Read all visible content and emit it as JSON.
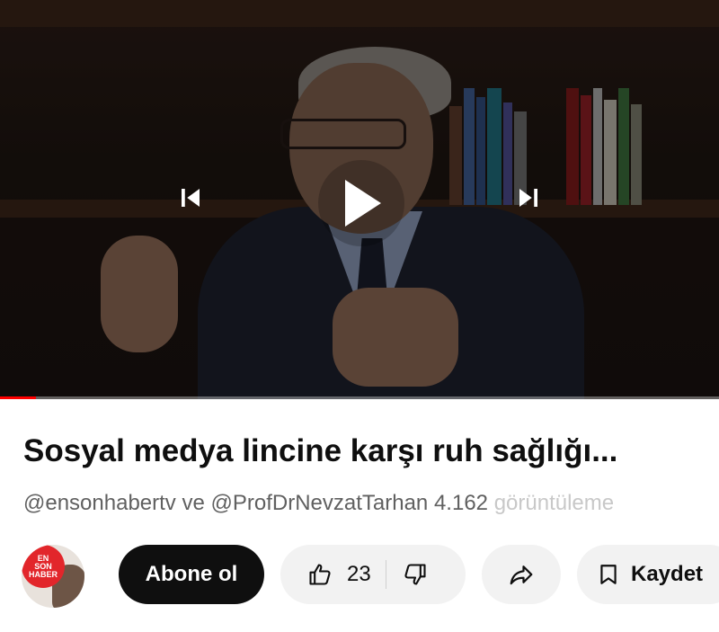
{
  "video": {
    "progress_fraction": 0.05
  },
  "title": "Sosyal medya lincine karşı ruh sağlığı...",
  "meta": {
    "channels": "@ensonhabertv ve @ProfDrNevzatTarhan",
    "views": "4.162",
    "views_label": "görüntüleme"
  },
  "channel_avatar": {
    "logo_line1": "EN",
    "logo_line2": "SON",
    "logo_line3": "HABER"
  },
  "actions": {
    "subscribe_label": "Abone ol",
    "like_count": "23",
    "save_label": "Kaydet"
  },
  "icons": {
    "prev": "skip-previous-icon",
    "play": "play-icon",
    "next": "skip-next-icon",
    "like": "thumb-up-icon",
    "dislike": "thumb-down-icon",
    "share": "share-icon",
    "save": "bookmark-icon"
  },
  "colors": {
    "progress": "#ff0000",
    "subscribe_bg": "#0f0f0f",
    "logo_red": "#e2262b"
  }
}
